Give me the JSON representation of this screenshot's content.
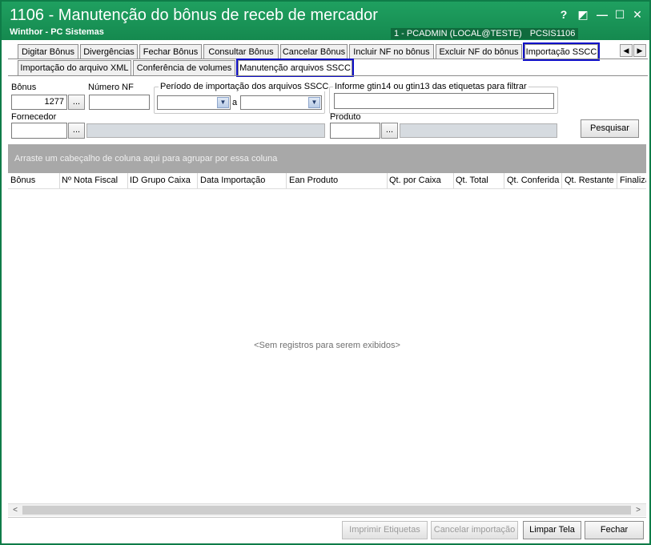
{
  "window": {
    "title": "1106 - Manutenção do bônus de receb de mercador",
    "subtitle": "Winthor - PC Sistemas",
    "user_info": "1 - PCADMIN (LOCAL@TESTE)",
    "program_code": "PCSIS1106",
    "controls": {
      "help": "?",
      "restore": "◩",
      "minimize": "—",
      "maximize": "☐",
      "close": "✕"
    }
  },
  "tabs_row1": [
    "Digitar Bônus",
    "Divergências",
    "Fechar Bônus",
    "Consultar Bônus",
    "Cancelar Bônus",
    "Incluir NF no bônus",
    "Excluir NF do bônus",
    "Importação SSCC"
  ],
  "tab_nav": {
    "prev": "◀",
    "next": "▶"
  },
  "tabs_row2": [
    "Importação do arquivo XML",
    "Conferência de volumes",
    "Manutenção arquivos SSCC"
  ],
  "filters": {
    "bonus_label": "Bônus",
    "bonus_value": "1277",
    "numero_nf_label": "Número NF",
    "numero_nf_value": "",
    "periodo_label": "Período de importação dos arquivos SSCC",
    "periodo_sep": "a",
    "gtin_label": "Informe gtin14 ou gtin13 das etiquetas para filtrar",
    "gtin_value": "",
    "fornecedor_label": "Fornecedor",
    "produto_label": "Produto",
    "dots": "...",
    "pesquisar": "Pesquisar"
  },
  "grid": {
    "group_hint": "Arraste um cabeçalho de coluna aqui para agrupar por essa coluna",
    "columns": [
      "Bônus",
      "Nº Nota Fiscal",
      "ID Grupo Caixa",
      "Data Importação",
      "Ean Produto",
      "Qt. por Caixa",
      "Qt. Total",
      "Qt. Conferida",
      "Qt. Restante",
      "Finaliza"
    ],
    "empty_text": "<Sem registros para serem exibidos>",
    "scroll_left": "<",
    "scroll_right": ">"
  },
  "footer": {
    "imprimir": "Imprimir Etiquetas",
    "cancelar": "Cancelar importação",
    "limpar": "Limpar Tela",
    "fechar": "Fechar"
  },
  "colors": {
    "titlebar": "#1fa060",
    "highlight": "#1010c8",
    "group_bar": "#a8a8a8"
  }
}
